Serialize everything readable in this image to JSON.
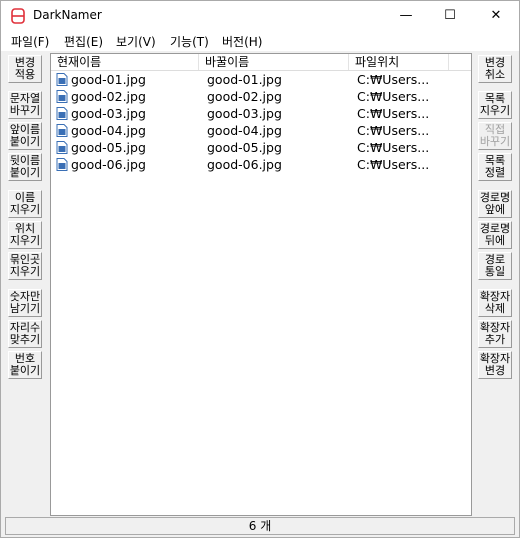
{
  "window": {
    "title": "DarkNamer",
    "minimize": "—",
    "maximize": "☐",
    "close": "✕"
  },
  "menu": [
    "파일(F)",
    "편집(E)",
    "보기(V)",
    "기능(T)",
    "버전(H)"
  ],
  "left_buttons": [
    {
      "label": "변경\n적용",
      "enabled": true
    },
    {
      "label": "문자열\n바꾸기",
      "enabled": true
    },
    {
      "label": "앞이름\n붙이기",
      "enabled": true
    },
    {
      "label": "뒷이름\n붙이기",
      "enabled": true
    },
    {
      "label": "이름\n지우기",
      "enabled": true
    },
    {
      "label": "위치\n지우기",
      "enabled": true
    },
    {
      "label": "묶인곳\n지우기",
      "enabled": true
    },
    {
      "label": "숫자만\n남기기",
      "enabled": true
    },
    {
      "label": "자리수\n맞추기",
      "enabled": true
    },
    {
      "label": "번호\n붙이기",
      "enabled": true
    }
  ],
  "right_buttons": [
    {
      "label": "변경\n취소",
      "enabled": true
    },
    {
      "label": "목록\n지우기",
      "enabled": true
    },
    {
      "label": "직접\n바꾸기",
      "enabled": false
    },
    {
      "label": "목록\n정렬",
      "enabled": true
    },
    {
      "label": "경로명\n앞에",
      "enabled": true
    },
    {
      "label": "경로명\n뒤에",
      "enabled": true
    },
    {
      "label": "경로\n통일",
      "enabled": true
    },
    {
      "label": "확장자\n삭제",
      "enabled": true
    },
    {
      "label": "확장자\n추가",
      "enabled": true
    },
    {
      "label": "확장자\n변경",
      "enabled": true
    }
  ],
  "table": {
    "columns": [
      "현재이름",
      "바꿀이름",
      "파일위치"
    ],
    "rows": [
      {
        "current": "good-01.jpg",
        "new": "good-01.jpg",
        "path": "C:₩Users..."
      },
      {
        "current": "good-02.jpg",
        "new": "good-02.jpg",
        "path": "C:₩Users..."
      },
      {
        "current": "good-03.jpg",
        "new": "good-03.jpg",
        "path": "C:₩Users..."
      },
      {
        "current": "good-04.jpg",
        "new": "good-04.jpg",
        "path": "C:₩Users..."
      },
      {
        "current": "good-05.jpg",
        "new": "good-05.jpg",
        "path": "C:₩Users..."
      },
      {
        "current": "good-06.jpg",
        "new": "good-06.jpg",
        "path": "C:₩Users..."
      }
    ]
  },
  "status": {
    "count": "6 개"
  },
  "colors": {
    "app_icon": "#e0303a",
    "file_icon": "#3a6fb5"
  }
}
